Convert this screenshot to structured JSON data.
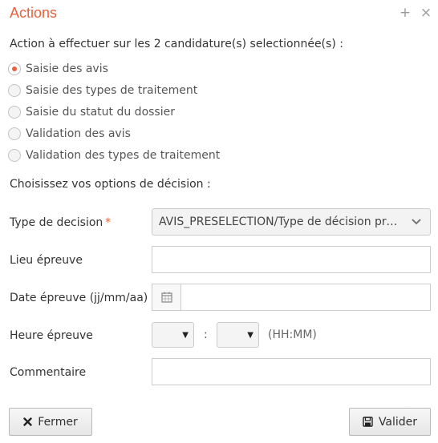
{
  "dialog": {
    "title": "Actions",
    "minimize_glyph": "+",
    "close_glyph": "×"
  },
  "action": {
    "prompt": "Action à effectuer sur les 2 candidature(s) selectionnée(s) :",
    "options": [
      {
        "label": "Saisie des avis",
        "checked": true
      },
      {
        "label": "Saisie des types de traitement",
        "checked": false
      },
      {
        "label": "Saisie du statut du dossier",
        "checked": false
      },
      {
        "label": "Validation des avis",
        "checked": false
      },
      {
        "label": "Validation des types de traitement",
        "checked": false
      }
    ]
  },
  "decision": {
    "section_label": "Choisissez vos options de décision :",
    "type_label": "Type de decision",
    "required_mark": "*",
    "type_value": "AVIS_PRESELECTION/Type de décision préselection",
    "lieu_label": "Lieu épreuve",
    "lieu_value": "",
    "date_label": "Date épreuve (jj/mm/aa)",
    "date_value": "",
    "heure_label": "Heure épreuve",
    "time_separator": ":",
    "time_hint": "(HH:MM)",
    "hour_value": "",
    "minute_value": "",
    "commentaire_label": "Commentaire",
    "commentaire_value": ""
  },
  "buttons": {
    "close_label": "Fermer",
    "close_icon": "x-icon",
    "validate_label": "Valider",
    "validate_icon": "save-icon"
  },
  "colors": {
    "accent": "#e8603c",
    "border": "#cccccc",
    "text": "#333333"
  }
}
